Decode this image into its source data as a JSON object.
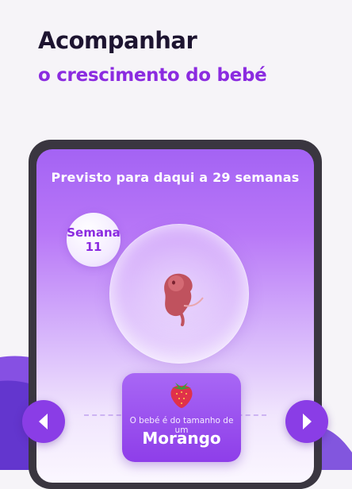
{
  "header": {
    "title": "Acompanhar",
    "subtitle": "o crescimento do bebé"
  },
  "screen": {
    "due_text": "Previsto para daqui a 29 semanas",
    "week_badge": {
      "label": "Semana",
      "number": "11"
    },
    "fruit_card": {
      "caption": "O bebé é do tamanho de um",
      "fruit": "Morango",
      "icon": "strawberry-icon"
    },
    "nav": {
      "prev_icon": "chevron-left-icon",
      "next_icon": "chevron-right-icon"
    }
  },
  "colors": {
    "accent": "#8b2be0",
    "title": "#1d1430",
    "gradient_top": "#a463f4",
    "card": "#8e3ee9"
  }
}
